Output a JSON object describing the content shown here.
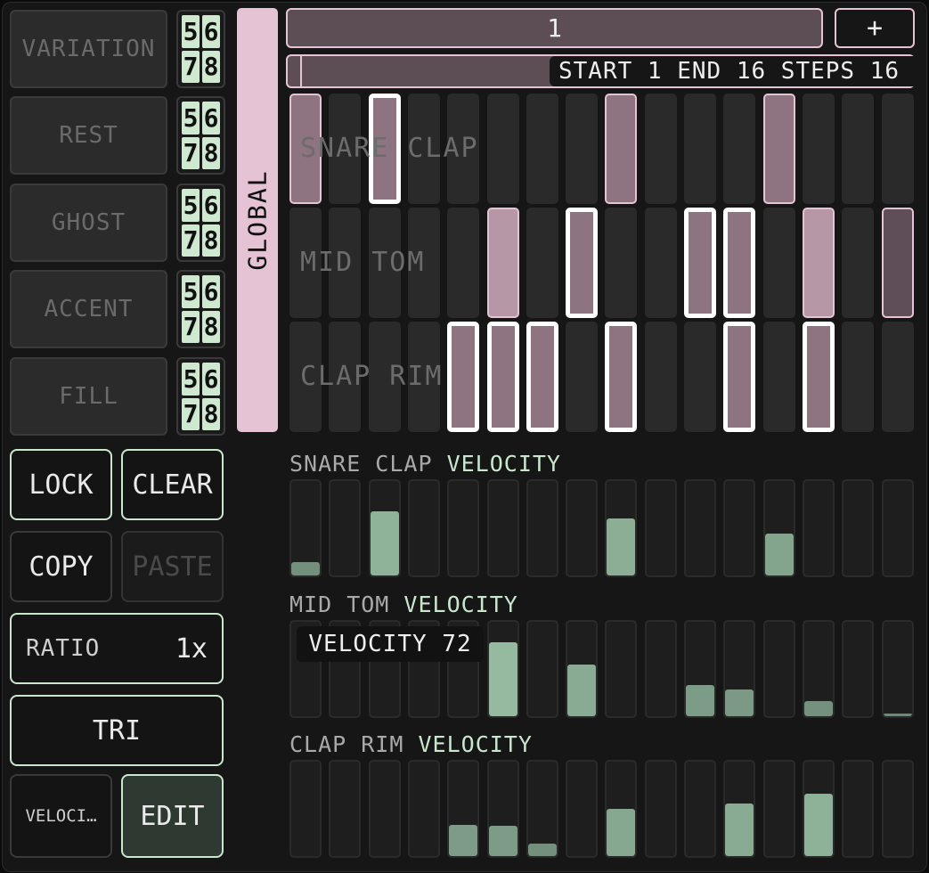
{
  "modifiers": [
    {
      "label": "VARIATION",
      "nums": [
        "5",
        "6",
        "7",
        "8"
      ]
    },
    {
      "label": "REST",
      "nums": [
        "5",
        "6",
        "7",
        "8"
      ]
    },
    {
      "label": "GHOST",
      "nums": [
        "5",
        "6",
        "7",
        "8"
      ]
    },
    {
      "label": "ACCENT",
      "nums": [
        "5",
        "6",
        "7",
        "8"
      ]
    },
    {
      "label": "FILL",
      "nums": [
        "5",
        "6",
        "7",
        "8"
      ]
    }
  ],
  "actions": {
    "lock": "LOCK",
    "clear": "CLEAR",
    "copy": "COPY",
    "paste": "PASTE",
    "ratio_label": "RATIO",
    "ratio_value": "1x",
    "tri": "TRI",
    "velocity": "VELOCI…",
    "edit": "EDIT"
  },
  "global_label": "GLOBAL",
  "pattern": {
    "value": "1",
    "add_label": "+"
  },
  "range": {
    "text": "START 1 END 16 STEPS 16",
    "start": 1,
    "end": 16,
    "steps": 16
  },
  "tracks": [
    {
      "name": "SNARE CLAP",
      "steps": [
        1,
        0,
        1,
        0,
        0,
        0,
        0,
        0,
        1,
        0,
        0,
        0,
        1,
        0,
        0,
        0
      ],
      "selected": [
        0,
        0,
        1,
        0,
        0,
        0,
        0,
        0,
        0,
        0,
        0,
        0,
        0,
        0,
        0,
        0
      ]
    },
    {
      "name": "MID TOM",
      "steps": [
        0,
        0,
        0,
        0,
        0,
        1,
        0,
        1,
        0,
        0,
        1,
        1,
        0,
        1,
        0,
        1
      ],
      "selected": [
        0,
        0,
        0,
        0,
        0,
        0,
        0,
        1,
        0,
        0,
        1,
        1,
        0,
        0,
        0,
        0
      ]
    },
    {
      "name": "CLAP RIM",
      "steps": [
        0,
        0,
        0,
        0,
        1,
        1,
        1,
        0,
        1,
        0,
        0,
        1,
        0,
        1,
        0,
        0
      ],
      "selected": [
        0,
        0,
        0,
        0,
        1,
        1,
        1,
        0,
        1,
        0,
        0,
        1,
        0,
        1,
        0,
        0
      ]
    }
  ],
  "velocity_suffix": "VELOCITY",
  "velocities": [
    [
      0.14,
      0,
      0.68,
      0,
      0,
      0,
      0,
      0,
      0.6,
      0,
      0,
      0,
      0.44,
      0,
      0,
      0
    ],
    [
      0,
      0,
      0,
      0,
      0,
      0.78,
      0,
      0.55,
      0,
      0,
      0.33,
      0.28,
      0,
      0.16,
      0,
      0.03
    ],
    [
      0,
      0,
      0,
      0,
      0.33,
      0.32,
      0.13,
      0,
      0.5,
      0,
      0,
      0.56,
      0,
      0.66,
      0,
      0
    ]
  ],
  "tooltip": "VELOCITY 72",
  "colors": {
    "accent_green": "#cbe6cf",
    "accent_pink": "#e6c3d4",
    "step_on": "#8d7480"
  }
}
